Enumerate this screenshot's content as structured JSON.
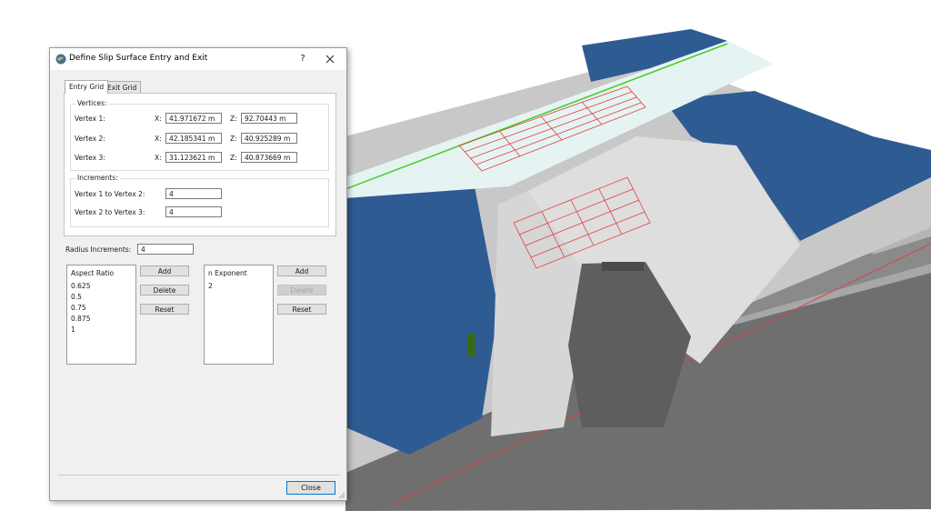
{
  "dialog": {
    "title": "Define Slip Surface Entry and Exit",
    "help_label": "?",
    "tabs": [
      {
        "label": "Entry Grid",
        "active": true
      },
      {
        "label": "Exit Grid",
        "active": false
      }
    ],
    "vertices": {
      "group_label": "Vertices:",
      "x_label": "X:",
      "z_label": "Z:",
      "rows": [
        {
          "label": "Vertex 1:",
          "x": "41.971672 m",
          "z": "92.70443 m"
        },
        {
          "label": "Vertex 2:",
          "x": "42.185341 m",
          "z": "40.925289 m"
        },
        {
          "label": "Vertex 3:",
          "x": "31.123621 m",
          "z": "40.873669 m"
        }
      ]
    },
    "increments": {
      "group_label": "Increments:",
      "rows": [
        {
          "label": "Vertex 1 to Vertex 2:",
          "value": "4"
        },
        {
          "label": "Vertex 2 to Vertex 3:",
          "value": "4"
        }
      ]
    },
    "radius_increments": {
      "label": "Radius Increments:",
      "value": "4"
    },
    "aspect_ratio": {
      "header": "Aspect Ratio",
      "items": [
        "0.625",
        "0.5",
        "0.75",
        "0.875",
        "1"
      ],
      "buttons": {
        "add": "Add",
        "delete": "Delete",
        "reset": "Reset"
      }
    },
    "n_exponent": {
      "header": "n Exponent",
      "items": [
        "2"
      ],
      "buttons": {
        "add": "Add",
        "delete": "Delete",
        "reset": "Reset"
      },
      "delete_enabled": false
    },
    "close_label": "Close"
  },
  "colors": {
    "water": "#2f5b93",
    "terrain": "#c8c8c8",
    "road": "#e6f3f3",
    "road_edge": "#44cc22",
    "grid_lines": "#e04040",
    "tunnel": "#5e5e5e",
    "base_dark": "#6f6f6f",
    "accent": "#0078d7"
  }
}
